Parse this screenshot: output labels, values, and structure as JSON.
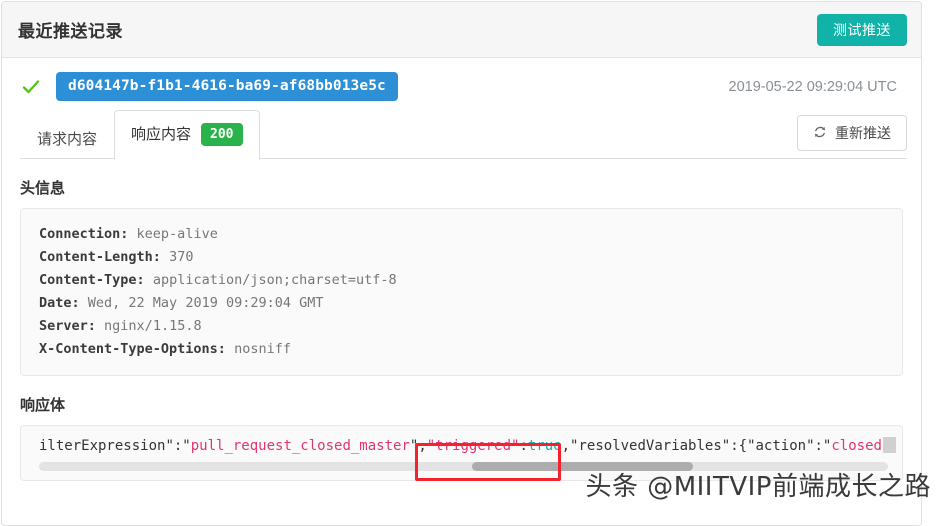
{
  "card": {
    "title": "最近推送记录",
    "test_button_label": "测试推送"
  },
  "delivery": {
    "status_icon": "check-icon",
    "uuid": "d604147b-f1b1-4616-ba69-af68bb013e5c",
    "timestamp": "2019-05-22 09:29:04 UTC"
  },
  "tabs": {
    "request_label": "请求内容",
    "response_label": "响应内容",
    "status_code": "200",
    "redeliver_label": "重新推送",
    "redeliver_icon": "refresh-icon"
  },
  "headers_section": {
    "title": "头信息",
    "rows": [
      {
        "key": "Connection:",
        "value": "keep-alive"
      },
      {
        "key": "Content-Length:",
        "value": "370"
      },
      {
        "key": "Content-Type:",
        "value": "application/json;charset=utf-8"
      },
      {
        "key": "Date:",
        "value": "Wed, 22 May 2019 09:29:04 GMT"
      },
      {
        "key": "Server:",
        "value": "nginx/1.15.8"
      },
      {
        "key": "X-Content-Type-Options:",
        "value": "nosniff"
      }
    ]
  },
  "body_section": {
    "title": "响应体",
    "tokens": [
      {
        "text": "ilterExpression",
        "type": "key"
      },
      {
        "text": "\":\"",
        "type": "punct"
      },
      {
        "text": "pull_request_closed_master",
        "type": "str"
      },
      {
        "text": "\",",
        "type": "punct"
      },
      {
        "text": "\"triggered\"",
        "type": "str"
      },
      {
        "text": ":",
        "type": "punct"
      },
      {
        "text": "true",
        "type": "bool"
      },
      {
        "text": ",\"",
        "type": "punct"
      },
      {
        "text": "resolvedVariables",
        "type": "key"
      },
      {
        "text": "\":{\"",
        "type": "punct"
      },
      {
        "text": "action",
        "type": "key"
      },
      {
        "text": "\":\"",
        "type": "punct"
      },
      {
        "text": "closed",
        "type": "str"
      }
    ],
    "full_text": "ilterExpression\":\"pull_request_closed_master\",\"triggered\":true,\"resolvedVariables\":{\"action\":\"closed"
  },
  "watermark": {
    "text": "头条 @MIITVIP前端成长之路"
  },
  "colors": {
    "teal_button": "#11b3a8",
    "uuid_blue": "#2d8fd5",
    "status_green": "#2ab34a",
    "highlight_red": "#f5222d",
    "string_pink": "#e0366a",
    "bool_teal": "#13b3b3"
  }
}
